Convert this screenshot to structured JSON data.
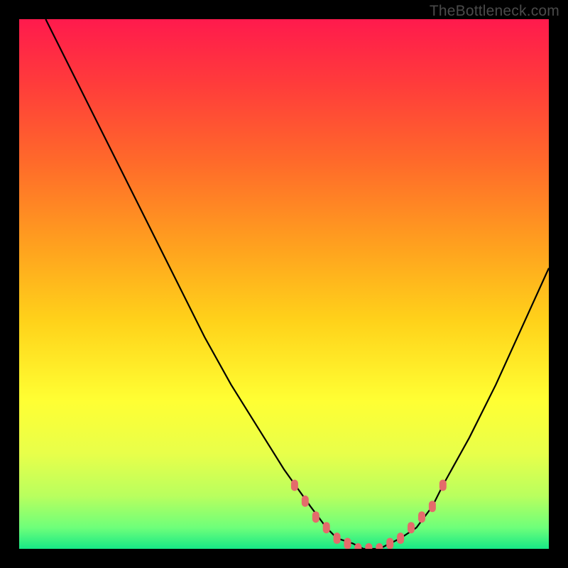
{
  "watermark": "TheBottleneck.com",
  "colors": {
    "background": "#000000",
    "gradient_top": "#ff1a4d",
    "gradient_bottom": "#17e886",
    "curve_stroke": "#000000",
    "marker_fill": "#e46b6b",
    "marker_stroke": "#c94f4f"
  },
  "chart_data": {
    "type": "line",
    "title": "",
    "xlabel": "",
    "ylabel": "",
    "xlim": [
      0,
      100
    ],
    "ylim": [
      0,
      100
    ],
    "grid": false,
    "legend": false,
    "annotations": [
      "TheBottleneck.com"
    ],
    "series": [
      {
        "name": "bottleneck-curve",
        "x": [
          5,
          10,
          15,
          20,
          25,
          30,
          35,
          40,
          45,
          50,
          55,
          58,
          60,
          63,
          65,
          68,
          70,
          72,
          75,
          78,
          80,
          85,
          90,
          95,
          100
        ],
        "y": [
          100,
          90,
          80,
          70,
          60,
          50,
          40,
          31,
          23,
          15,
          8,
          4,
          2,
          1,
          0,
          0,
          1,
          2,
          4,
          8,
          12,
          21,
          31,
          42,
          53
        ]
      }
    ],
    "markers": {
      "name": "highlighted-points",
      "x": [
        52,
        54,
        56,
        58,
        60,
        62,
        64,
        66,
        68,
        70,
        72,
        74,
        76,
        78,
        80
      ],
      "y": [
        12,
        9,
        6,
        4,
        2,
        1,
        0,
        0,
        0,
        1,
        2,
        4,
        6,
        8,
        12
      ]
    }
  }
}
